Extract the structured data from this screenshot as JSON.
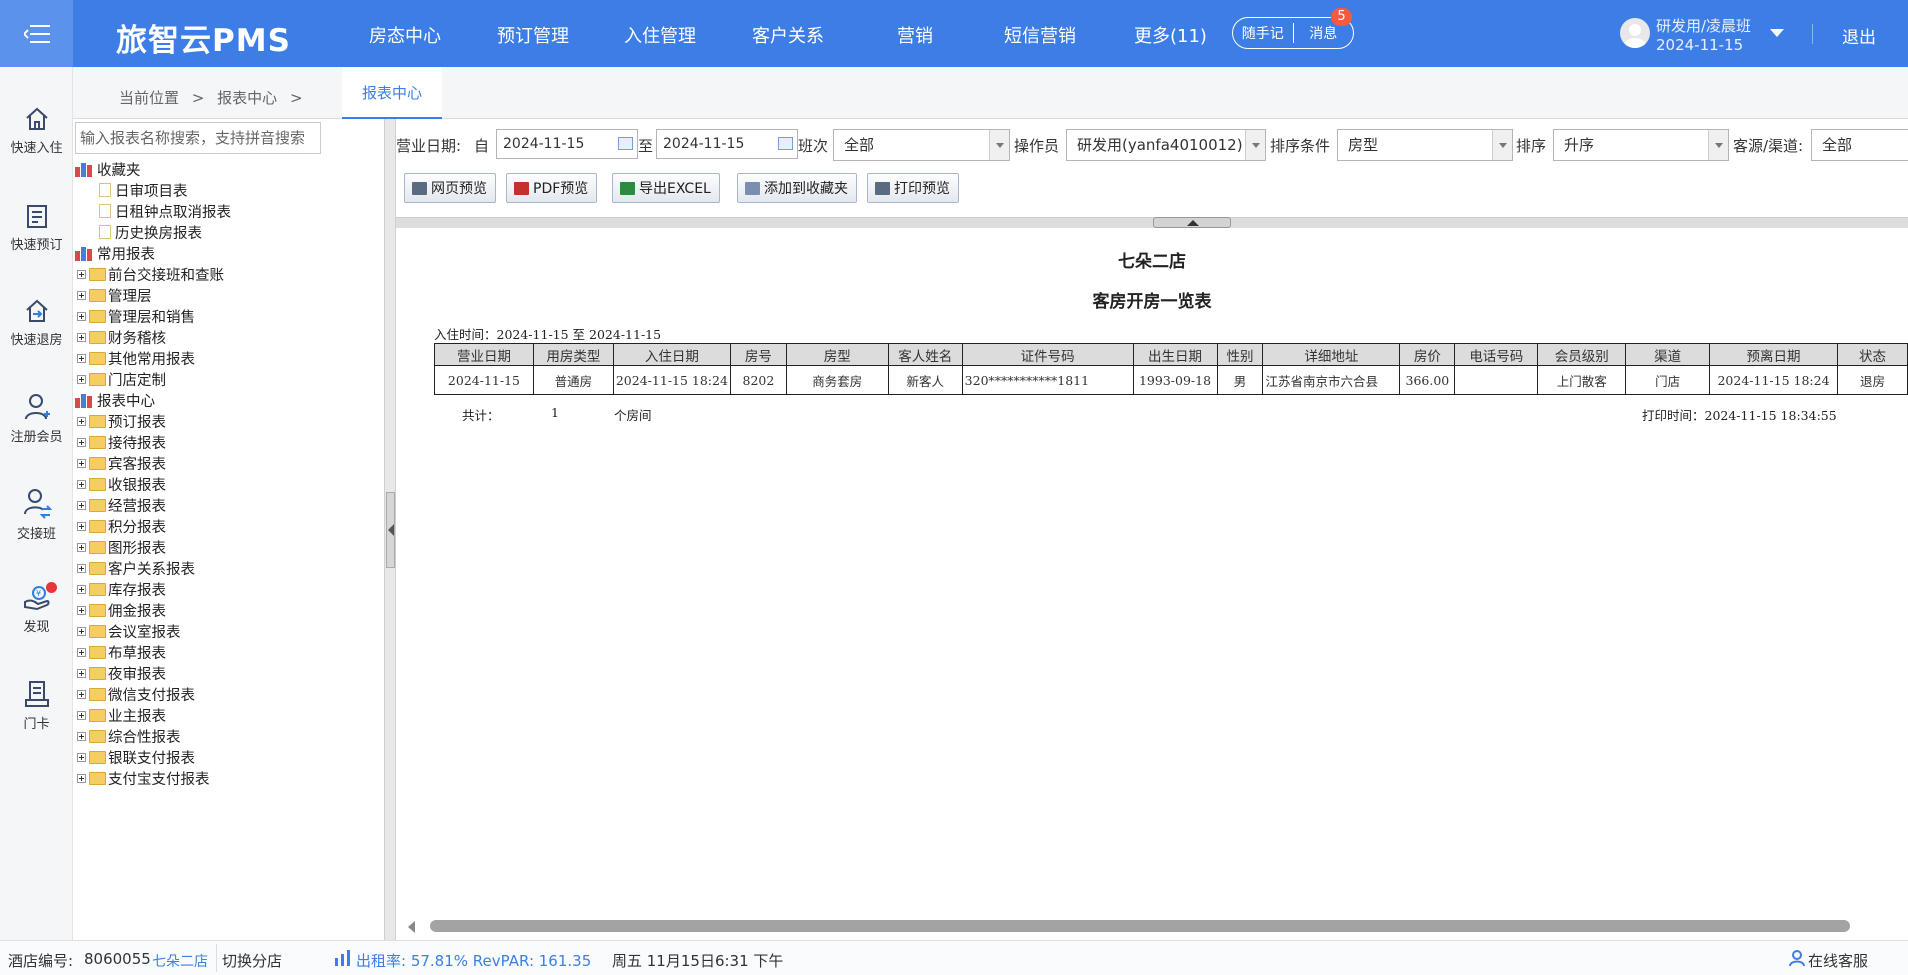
{
  "brand": "旅智云PMS",
  "nav": [
    "房态中心",
    "预订管理",
    "入住管理",
    "客户关系",
    "营销",
    "短信营销",
    "更多(11)"
  ],
  "header": {
    "notes_button": "随手记",
    "messages_button": "消息",
    "messages_badge": "5",
    "user_name": "研发用/凌晨班",
    "user_date": "2024-11-15",
    "logout": "退出"
  },
  "sidebar": [
    {
      "label": "快速入住",
      "icon": "home-icon"
    },
    {
      "label": "快速预订",
      "icon": "booking-list-icon"
    },
    {
      "label": "快速退房",
      "icon": "checkout-icon"
    },
    {
      "label": "注册会员",
      "icon": "add-member-icon"
    },
    {
      "label": "交接班",
      "icon": "shift-handover-icon"
    },
    {
      "label": "发现",
      "icon": "discover-icon"
    },
    {
      "label": "门卡",
      "icon": "door-card-icon"
    }
  ],
  "breadcrumb": {
    "items": [
      "当前位置",
      ">",
      "报表中心",
      ">"
    ],
    "active_tab": "报表中心"
  },
  "tree": {
    "search_placeholder": "输入报表名称搜索，支持拼音搜索",
    "nodes": [
      {
        "label": "收藏夹",
        "kind": "root"
      },
      {
        "label": "日审项目表",
        "kind": "leaf"
      },
      {
        "label": "日租钟点取消报表",
        "kind": "leaf"
      },
      {
        "label": "历史换房报表",
        "kind": "leaf"
      },
      {
        "label": "常用报表",
        "kind": "root"
      },
      {
        "label": "前台交接班和查账",
        "kind": "folder"
      },
      {
        "label": "管理层",
        "kind": "folder"
      },
      {
        "label": "管理层和销售",
        "kind": "folder"
      },
      {
        "label": "财务稽核",
        "kind": "folder"
      },
      {
        "label": "其他常用报表",
        "kind": "folder"
      },
      {
        "label": "门店定制",
        "kind": "folder"
      },
      {
        "label": "报表中心",
        "kind": "root"
      },
      {
        "label": "预订报表",
        "kind": "folder"
      },
      {
        "label": "接待报表",
        "kind": "folder"
      },
      {
        "label": "宾客报表",
        "kind": "folder"
      },
      {
        "label": "收银报表",
        "kind": "folder"
      },
      {
        "label": "经营报表",
        "kind": "folder"
      },
      {
        "label": "积分报表",
        "kind": "folder"
      },
      {
        "label": "图形报表",
        "kind": "folder"
      },
      {
        "label": "客户关系报表",
        "kind": "folder"
      },
      {
        "label": "库存报表",
        "kind": "folder"
      },
      {
        "label": "佣金报表",
        "kind": "folder"
      },
      {
        "label": "会议室报表",
        "kind": "folder"
      },
      {
        "label": "布草报表",
        "kind": "folder"
      },
      {
        "label": "夜审报表",
        "kind": "folder"
      },
      {
        "label": "微信支付报表",
        "kind": "folder"
      },
      {
        "label": "业主报表",
        "kind": "folder"
      },
      {
        "label": "综合性报表",
        "kind": "folder"
      },
      {
        "label": "银联支付报表",
        "kind": "folder"
      },
      {
        "label": "支付宝支付报表",
        "kind": "folder"
      }
    ]
  },
  "filters": {
    "biz_date_label": "营业日期:",
    "from_label": "自",
    "from_date": "2024-11-15",
    "to_label": "至",
    "to_date": "2024-11-15",
    "shift_label": "班次",
    "shift_value": "全部",
    "operator_label": "操作员",
    "operator_value": "研发用(yanfa4010012)",
    "sort_cond_label": "排序条件",
    "sort_cond_value": "房型",
    "sort_label": "排序",
    "sort_value": "升序",
    "source_label": "客源/渠道:",
    "source_value": "全部"
  },
  "toolbar": [
    "网页预览",
    "PDF预览",
    "导出EXCEL",
    "添加到收藏夹",
    "打印预览"
  ],
  "report": {
    "hotel": "七朵二店",
    "title": "客房开房一览表",
    "range": "入住时间：2024-11-15 至 2024-11-15",
    "columns": [
      "营业日期",
      "用房类型",
      "入住日期",
      "房号",
      "房型",
      "客人姓名",
      "证件号码",
      "出生日期",
      "性别",
      "详细地址",
      "房价",
      "电话号码",
      "会员级别",
      "渠道",
      "预离日期",
      "状态"
    ],
    "rows": [
      [
        "2024-11-15",
        "普通房",
        "2024-11-15 18:24",
        "8202",
        "商务套房",
        "新客人",
        "320***********1811",
        "1993-09-18",
        "男",
        "江苏省南京市六合县",
        "366.00",
        "",
        "上门散客",
        "门店",
        "2024-11-15 18:24",
        "退房"
      ]
    ],
    "total_label": "共计：",
    "total_count": "1",
    "total_unit": "个房间",
    "print_time": "打印时间：2024-11-15 18:34:55"
  },
  "status": {
    "hotel_no_label": "酒店编号:",
    "hotel_no": "8060055",
    "store_name": "七朵二店",
    "switch_store": "切换分店",
    "occupancy": "出租率: 57.81% RevPAR: 161.35",
    "datetime": "周五 11月15日6:31 下午",
    "support": "在线客服"
  }
}
